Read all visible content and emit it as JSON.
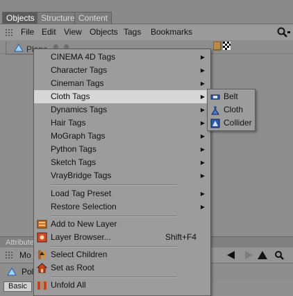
{
  "tabs": [
    "Objects",
    "Structure",
    "Content"
  ],
  "menubar": [
    "File",
    "Edit",
    "View",
    "Objects",
    "Tags",
    "Bookmarks"
  ],
  "object_row": {
    "name": "Plane"
  },
  "attributes": {
    "tab": "Attribute",
    "mode_label": "Mo",
    "object_label": "Pol",
    "basic_tab": "Basic"
  },
  "context_menu": {
    "items": [
      {
        "label": "CINEMA 4D Tags",
        "submenu": true
      },
      {
        "label": "Character Tags",
        "submenu": true
      },
      {
        "label": "Cineman Tags",
        "submenu": true
      },
      {
        "label": "Cloth Tags",
        "submenu": true,
        "highlighted": true
      },
      {
        "label": "Dynamics Tags",
        "submenu": true
      },
      {
        "label": "Hair Tags",
        "submenu": true
      },
      {
        "label": "MoGraph Tags",
        "submenu": true
      },
      {
        "label": "Python Tags",
        "submenu": true
      },
      {
        "label": "Sketch Tags",
        "submenu": true
      },
      {
        "label": "VrayBridge Tags",
        "submenu": true
      },
      {
        "label": "Load Tag Preset",
        "submenu": true
      },
      {
        "label": "Restore Selection",
        "submenu": true
      },
      {
        "label": "Add to New Layer",
        "icon": "layer-add-icon"
      },
      {
        "label": "Layer Browser...",
        "shortcut": "Shift+F4",
        "icon": "layer-browser-icon"
      },
      {
        "label": "Select Children",
        "icon": "select-children-icon"
      },
      {
        "label": "Set as Root",
        "icon": "set-root-icon"
      },
      {
        "label": "Unfold All",
        "icon": "unfold-icon"
      }
    ]
  },
  "cloth_submenu": [
    {
      "label": "Belt",
      "icon": "belt-icon"
    },
    {
      "label": "Cloth",
      "icon": "cloth-icon"
    },
    {
      "label": "Collider",
      "icon": "collider-icon"
    }
  ]
}
